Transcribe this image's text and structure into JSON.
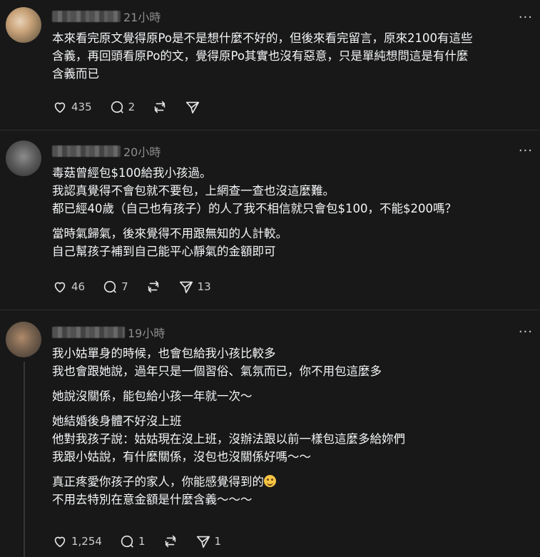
{
  "posts": [
    {
      "time": "21小時",
      "lines": [
        "本來看完原文覺得原Po是不是想什麼不好的，但後來看完留言，原來2100有這些",
        "含義，再回頭看原Po的文，覺得原Po其實也沒有惡意，只是單純想問這是有什麼",
        "含義而已"
      ],
      "likes": "435",
      "replies": "2",
      "reposts": "",
      "shares": ""
    },
    {
      "time": "20小時",
      "lines": [
        "毒菇曾經包$100給我小孩過。",
        "我認真覺得不會包就不要包，上網查一查也沒這麼難。",
        "都已經40歲（自己也有孩子）的人了我不相信就只會包$100，不能$200嗎？",
        "",
        "當時氣歸氣，後來覺得不用跟無知的人計較。",
        "自己幫孩子補到自己能平心靜氣的金額即可"
      ],
      "likes": "46",
      "replies": "7",
      "reposts": "",
      "shares": "13"
    },
    {
      "time": "19小時",
      "lines": [
        "我小姑單身的時候，也會包給我小孩比較多",
        "我也會跟她說，過年只是一個習俗、氣氛而已，你不用包這麼多",
        "",
        "她說沒關係，能包給小孩一年就一次～",
        "",
        "她結婚後身體不好沒上班",
        "他對我孩子說：姑姑現在沒上班，沒辦法跟以前一樣包這麼多給妳們",
        "我跟小姑說，有什麼關係，沒包也沒關係好嗎～～",
        "",
        "真正疼愛你孩子的家人，你能感覺得到的",
        "不用去特別在意金額是什麼含義～～～"
      ],
      "likes": "1,254",
      "replies": "1",
      "reposts": "",
      "shares": "1"
    }
  ],
  "icons": {
    "like": "heart-icon",
    "reply": "comment-icon",
    "repost": "repost-icon",
    "share": "send-icon",
    "more": "more-dots-icon",
    "emoji": "smiling-face-emoji"
  }
}
